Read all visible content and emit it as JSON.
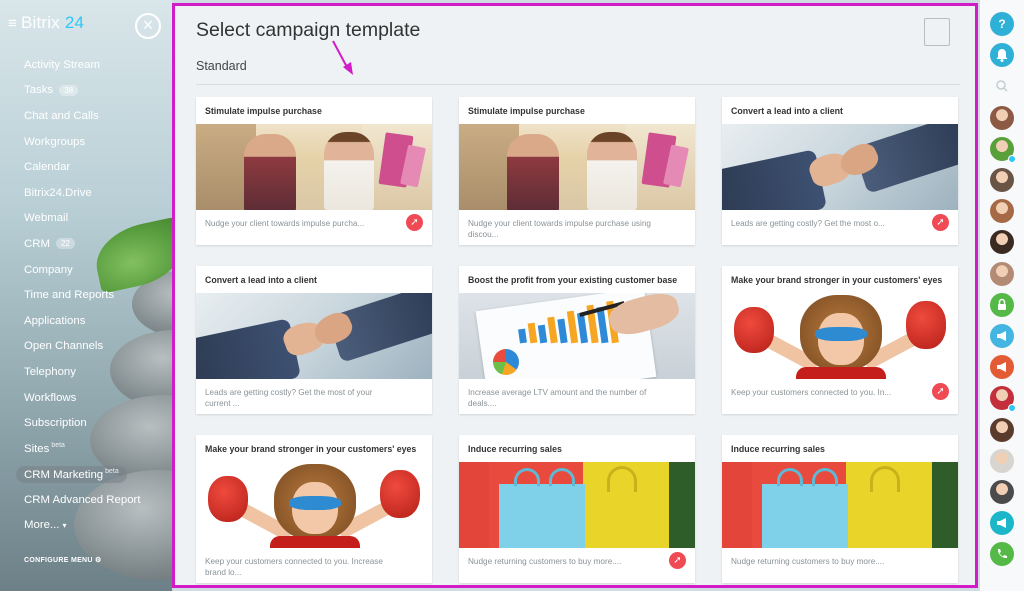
{
  "sidebar": {
    "logo_text": "Bitrix",
    "logo_number": "24",
    "close_glyph": "×",
    "items": [
      {
        "label": "Activity Stream"
      },
      {
        "label": "Tasks",
        "badge": "38"
      },
      {
        "label": "Chat and Calls"
      },
      {
        "label": "Workgroups"
      },
      {
        "label": "Calendar"
      },
      {
        "label": "Bitrix24.Drive"
      },
      {
        "label": "Webmail"
      },
      {
        "label": "CRM",
        "badge": "22"
      },
      {
        "label": "Company"
      },
      {
        "label": "Time and Reports"
      },
      {
        "label": "Applications"
      },
      {
        "label": "Open Channels"
      },
      {
        "label": "Telephony"
      },
      {
        "label": "Workflows"
      },
      {
        "label": "Subscription"
      },
      {
        "label": "Sites",
        "sup": "beta"
      },
      {
        "label": "CRM Marketing",
        "sup": "beta"
      },
      {
        "label": "CRM Advanced Report"
      },
      {
        "label": "More...",
        "caret": "▾"
      }
    ],
    "configure_label": "CONFIGURE MENU",
    "configure_icon": "⚙"
  },
  "main": {
    "title": "Select campaign template",
    "section": "Standard",
    "accent": "#d11cc8"
  },
  "cards": [
    {
      "title": "Stimulate impulse purchase",
      "desc": "Nudge your client towards impulse purcha...",
      "image": "shopping-couple",
      "icon": true
    },
    {
      "title": "Stimulate impulse purchase",
      "desc": "Nudge your client towards impulse purchase using discou...",
      "image": "shopping-couple",
      "icon": false
    },
    {
      "title": "Convert a lead into a client",
      "desc": "Leads are getting costly? Get the most o...",
      "image": "handshake",
      "icon": true
    },
    {
      "title": "Convert a lead into a client",
      "desc": "Leads are getting costly? Get the most of your current ...",
      "image": "handshake",
      "icon": false
    },
    {
      "title": "Boost the profit from your existing customer base",
      "desc": "Increase average LTV amount and the number of deals....",
      "image": "chart-report",
      "icon": false
    },
    {
      "title": "Make your brand stronger in your customers' eyes",
      "desc": "Keep your customers connected to you. In...",
      "image": "superhero-kid",
      "icon": true
    },
    {
      "title": "Make your brand stronger in your customers' eyes",
      "desc": "Keep your customers connected to you. Increase brand lo...",
      "image": "superhero-kid",
      "icon": false
    },
    {
      "title": "Induce recurring sales",
      "desc": "Nudge returning customers to buy more....",
      "image": "shopping-bags",
      "icon": true
    },
    {
      "title": "Induce recurring sales",
      "desc": "Nudge returning customers to buy more....",
      "image": "shopping-bags",
      "icon": false
    }
  ],
  "rail": {
    "help_glyph": "?",
    "items": [
      {
        "name": "help-icon",
        "color": "#2fb0d6"
      },
      {
        "name": "bell-icon",
        "color": "#2fb0d6"
      },
      {
        "name": "search-icon",
        "color": "#c4cdd1"
      },
      {
        "name": "user-avatar",
        "color": "#8c5a44"
      },
      {
        "name": "user-avatar",
        "color": "#5aa03a"
      },
      {
        "name": "user-avatar",
        "color": "#6a5445"
      },
      {
        "name": "user-avatar",
        "color": "#a56a45"
      },
      {
        "name": "user-avatar",
        "color": "#3a2a22"
      },
      {
        "name": "user-avatar",
        "color": "#b38a74"
      },
      {
        "name": "lock-chat-icon",
        "color": "#55b947"
      },
      {
        "name": "megaphone-chat-icon",
        "color": "#43b5e0"
      },
      {
        "name": "megaphone-chat-icon",
        "color": "#e25b35"
      },
      {
        "name": "user-avatar",
        "color": "#c3303c"
      },
      {
        "name": "user-avatar",
        "color": "#5b3b2c"
      },
      {
        "name": "user-avatar",
        "color": "#d8d4d0"
      },
      {
        "name": "user-avatar",
        "color": "#4b4b4b"
      },
      {
        "name": "megaphone-chat-icon",
        "color": "#1cb6c9"
      },
      {
        "name": "phone-icon",
        "color": "#55b947"
      }
    ]
  }
}
